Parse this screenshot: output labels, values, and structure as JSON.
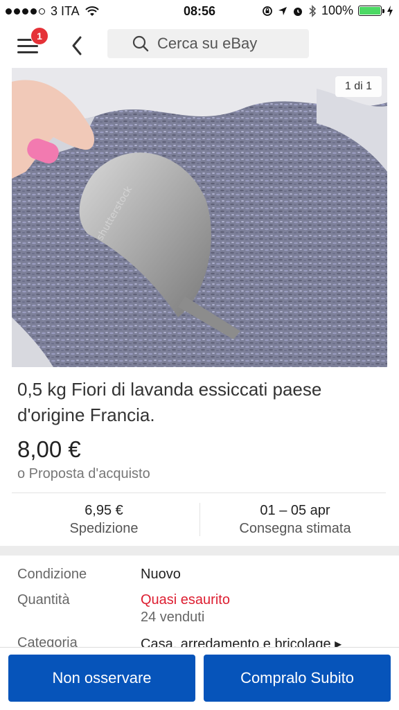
{
  "status_bar": {
    "carrier": "3 ITA",
    "time": "08:56",
    "battery": "100%"
  },
  "header": {
    "notification_count": "1",
    "search_placeholder": "Cerca su eBay"
  },
  "image": {
    "counter": "1 di 1"
  },
  "listing": {
    "title": "0,5 kg Fiori di lavanda essiccati paese d'origine Francia.",
    "price": "8,00 €",
    "offer": "o Proposta d'acquisto"
  },
  "shipping": {
    "cost": "6,95 €",
    "cost_label": "Spedizione",
    "delivery": "01 – 05 apr",
    "delivery_label": "Consegna stimata"
  },
  "specs": {
    "condition_label": "Condizione",
    "condition_value": "Nuovo",
    "quantity_label": "Quantità",
    "quantity_value": "Quasi esaurito",
    "quantity_sold": "24 venduti",
    "category_label": "Categoria",
    "category_value": "Casa, arredamento e bricolage ▸"
  },
  "buttons": {
    "unwatch": "Non osservare",
    "buy_now": "Compralo Subito"
  },
  "colors": {
    "primary_button": "#0654ba",
    "badge": "#e53238",
    "low_stock": "#dd1e31",
    "battery": "#4cd964"
  }
}
